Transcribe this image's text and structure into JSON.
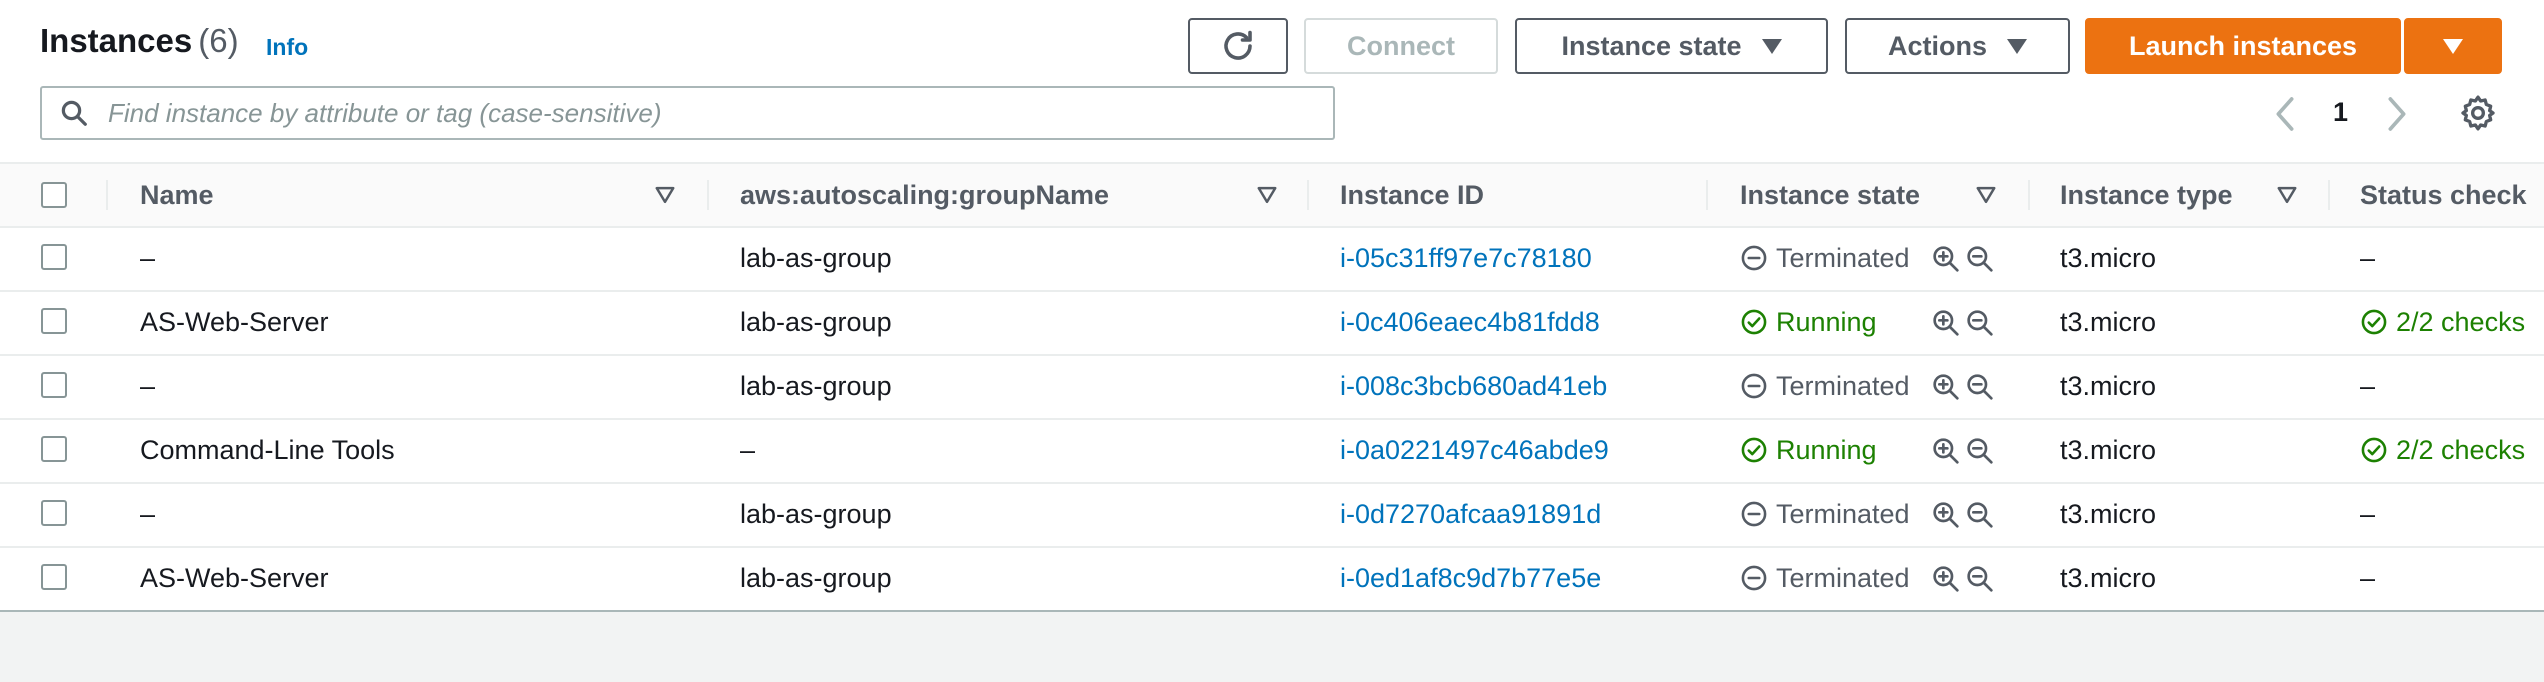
{
  "header": {
    "title": "Instances",
    "count": "(6)",
    "info_label": "Info"
  },
  "toolbar": {
    "connect_label": "Connect",
    "instance_state_label": "Instance state",
    "actions_label": "Actions",
    "launch_label": "Launch instances"
  },
  "search": {
    "placeholder": "Find instance by attribute or tag (case-sensitive)"
  },
  "pagination": {
    "current_page": "1"
  },
  "table": {
    "columns": [
      "Name",
      "aws:autoscaling:groupName",
      "Instance ID",
      "Instance state",
      "Instance type",
      "Status check"
    ],
    "rows": [
      {
        "name": "–",
        "group": "lab-as-group",
        "instance_id": "i-05c31ff97e7c78180",
        "state": "Terminated",
        "type": "t3.micro",
        "status": "–"
      },
      {
        "name": "AS-Web-Server",
        "group": "lab-as-group",
        "instance_id": "i-0c406eaec4b81fdd8",
        "state": "Running",
        "type": "t3.micro",
        "status": "2/2 checks"
      },
      {
        "name": "–",
        "group": "lab-as-group",
        "instance_id": "i-008c3bcb680ad41eb",
        "state": "Terminated",
        "type": "t3.micro",
        "status": "–"
      },
      {
        "name": "Command-Line Tools",
        "group": "–",
        "instance_id": "i-0a0221497c46abde9",
        "state": "Running",
        "type": "t3.micro",
        "status": "2/2 checks"
      },
      {
        "name": "–",
        "group": "lab-as-group",
        "instance_id": "i-0d7270afcaa91891d",
        "state": "Terminated",
        "type": "t3.micro",
        "status": "–"
      },
      {
        "name": "AS-Web-Server",
        "group": "lab-as-group",
        "instance_id": "i-0ed1af8c9d7b77e5e",
        "state": "Terminated",
        "type": "t3.micro",
        "status": "–"
      }
    ]
  },
  "colors": {
    "accent_orange": "#ec7211",
    "link_blue": "#0073bb",
    "running_green": "#1d8102",
    "text_secondary": "#545b64"
  }
}
